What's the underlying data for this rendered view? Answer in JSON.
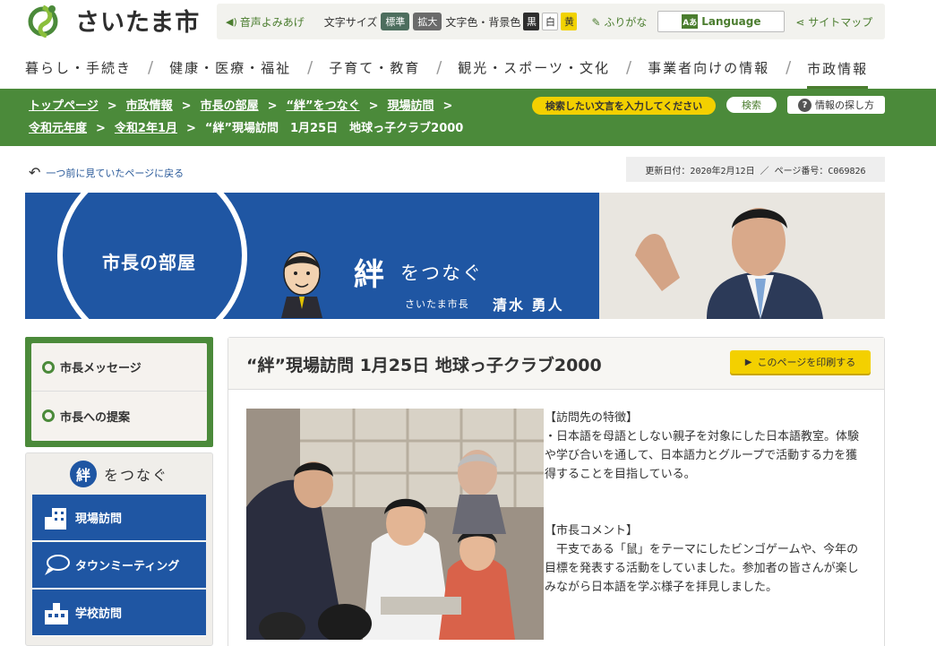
{
  "site": {
    "logo_text": "さいたま市"
  },
  "util": {
    "voice": "音声よみあげ",
    "font_size_label": "文字サイズ",
    "font_std": "標準",
    "font_big": "拡大",
    "color_label": "文字色・背景色",
    "color_black": "黒",
    "color_white": "白",
    "color_yellow": "黄",
    "furigana": "ふりがな",
    "language": "Language",
    "sitemap": "サイトマップ"
  },
  "gnav": [
    "暮らし・手続き",
    "健康・医療・福祉",
    "子育て・教育",
    "観光・スポーツ・文化",
    "事業者向けの情報",
    "市政情報"
  ],
  "breadcrumb": {
    "items": [
      "トップページ",
      "市政情報",
      "市長の部屋",
      "“絆”をつなぐ",
      "現場訪問",
      "令和元年度",
      "令和2年1月"
    ],
    "current": "“絆”現場訪問　1月25日　地球っ子クラブ2000",
    "arrow": ">"
  },
  "search": {
    "placeholder": "検索したい文言を入力してください",
    "button": "検索",
    "howto": "情報の探し方"
  },
  "back_link": "一つ前に見ていたページに戻る",
  "updated": "更新日付：2020年2月12日 ／ ページ番号：C069826",
  "banner": {
    "room": "市長の部屋",
    "kizuna": "絆",
    "wotsunagu": "をつなぐ",
    "mayor_label": "さいたま市長",
    "mayor_name": "清水 勇人"
  },
  "side_menu": [
    "市長メッセージ",
    "市長への提案"
  ],
  "kizuna_menu": {
    "badge": "絆",
    "title": "をつなぐ",
    "items": [
      "現場訪問",
      "タウンミーティング",
      "学校訪問"
    ]
  },
  "article": {
    "title": "“絆”現場訪問 1月25日 地球っ子クラブ2000",
    "print": "このページを印刷する",
    "section1_head": "【訪問先の特徴】",
    "section1_body": "・日本語を母語としない親子を対象にした日本語教室。体験や学び合いを通して、日本語力とグループで活動する力を獲得することを目指している。",
    "section2_head": "【市長コメント】",
    "section2_body": "　干支である「鼠」をテーマにしたビンゴゲームや、今年の目標を発表する活動をしていました。参加者の皆さんが楽しみながら日本語を学ぶ様子を拝見しました。"
  },
  "colors": {
    "brand_green": "#4b8a3a",
    "banner_blue": "#1f56a3",
    "accent_yellow": "#f3d000"
  },
  "icons": [
    "saitama-logo-icon",
    "speaker-icon",
    "pencil-icon",
    "language-icon",
    "share-icon",
    "question-icon",
    "back-arrow-icon",
    "building-icon",
    "speech-bubble-icon",
    "school-icon",
    "chevron-right-icon"
  ]
}
